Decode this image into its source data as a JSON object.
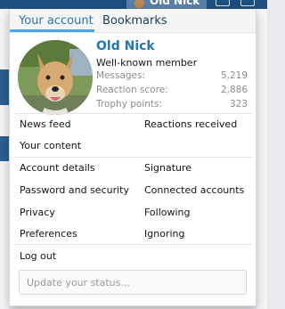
{
  "header": {
    "username": "Old Nick"
  },
  "tabs": [
    {
      "label": "Your account",
      "active": true
    },
    {
      "label": "Bookmarks",
      "active": false
    }
  ],
  "profile": {
    "name": "Old Nick",
    "title": "Well-known member",
    "stats": [
      {
        "label": "Messages:",
        "value": "5,219"
      },
      {
        "label": "Reaction score:",
        "value": "2,886"
      },
      {
        "label": "Trophy points:",
        "value": "323"
      }
    ]
  },
  "links": {
    "news_feed": "News feed",
    "reactions_received": "Reactions received",
    "your_content": "Your content",
    "account_details": "Account details",
    "signature": "Signature",
    "password_security": "Password and security",
    "connected_accounts": "Connected accounts",
    "privacy": "Privacy",
    "following": "Following",
    "preferences": "Preferences",
    "ignoring": "Ignoring",
    "log_out": "Log out"
  },
  "status": {
    "placeholder": "Update your status..."
  },
  "colors": {
    "accent": "#2577b1",
    "tab_indicator": "#47a7eb",
    "topbar": "#1d4f7e"
  }
}
